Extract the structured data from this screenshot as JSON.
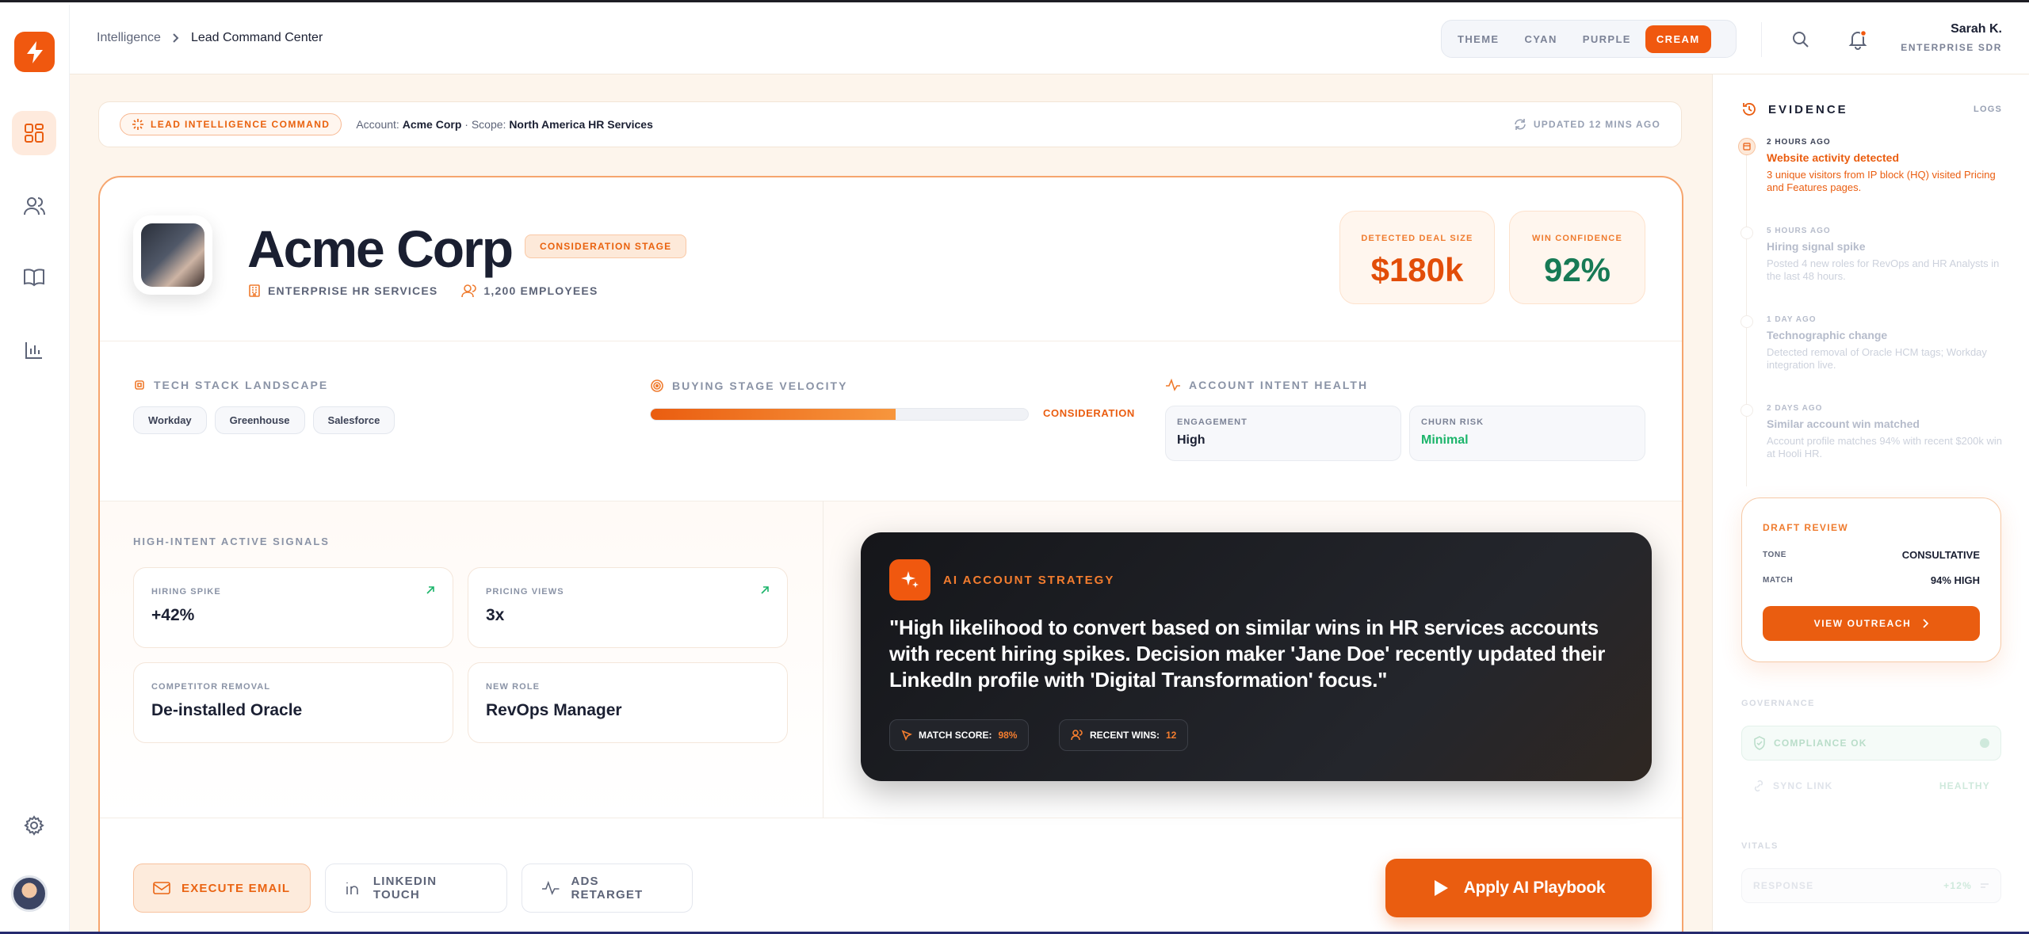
{
  "header": {
    "breadcrumb": [
      "Intelligence",
      "Lead Command Center"
    ],
    "theme_options": [
      "THEME",
      "CYAN",
      "PURPLE",
      "CREAM"
    ],
    "active_theme": "CREAM",
    "user": {
      "name": "Sarah K.",
      "role": "ENTERPRISE SDR"
    }
  },
  "sidebar": {
    "icons": [
      "dashboard-icon",
      "users-icon",
      "book-icon",
      "bar-chart-icon",
      "settings-icon"
    ]
  },
  "command_bar": {
    "badge": "LEAD INTELLIGENCE COMMAND",
    "account_label": "Account:",
    "account": "Acme Corp",
    "scope_label": "· Scope:",
    "scope": "North America HR Services",
    "updated": "UPDATED 12 MINS AGO"
  },
  "company": {
    "name": "Acme Corp",
    "stage_badge": "CONSIDERATION STAGE",
    "industry": "ENTERPRISE HR SERVICES",
    "employees": "1,200 EMPLOYEES"
  },
  "kpis": {
    "deal_size_label": "DETECTED DEAL SIZE",
    "deal_size": "$180k",
    "win_conf_label": "WIN CONFIDENCE",
    "win_conf": "92%"
  },
  "tech_stack": {
    "title": "TECH STACK LANDSCAPE",
    "items": [
      "Workday",
      "Greenhouse",
      "Salesforce"
    ]
  },
  "velocity": {
    "title": "BUYING STAGE VELOCITY",
    "stage": "CONSIDERATION",
    "progress": 0.65
  },
  "intent": {
    "title": "ACCOUNT INTENT HEALTH",
    "engagement_label": "ENGAGEMENT",
    "engagement": "High",
    "churn_label": "CHURN RISK",
    "churn": "Minimal",
    "churn_color": "#1bb46a"
  },
  "signals": {
    "title": "HIGH-INTENT ACTIVE SIGNALS",
    "items": [
      {
        "label": "HIRING SPIKE",
        "value": "+42%"
      },
      {
        "label": "PRICING VIEWS",
        "value": "3x"
      },
      {
        "label": "COMPETITOR REMOVAL",
        "value": "De-installed Oracle"
      },
      {
        "label": "NEW ROLE",
        "value": "RevOps Manager"
      }
    ]
  },
  "ai_strategy": {
    "title": "AI ACCOUNT STRATEGY",
    "text": "\"High likelihood to convert based on similar wins in HR services accounts with recent hiring spikes. Decision maker 'Jane Doe' recently updated their LinkedIn profile with 'Digital Transformation' focus.\"",
    "match_label": "MATCH SCORE:",
    "match_value": "98%",
    "wins_label": "RECENT WINS:",
    "wins_value": "12"
  },
  "actions": {
    "email": "EXECUTE EMAIL",
    "linkedin": "LINKEDIN TOUCH",
    "ads": "ADS RETARGET",
    "apply": "Apply AI Playbook"
  },
  "evidence": {
    "title": "EVIDENCE",
    "logs": "LOGS",
    "items": [
      {
        "time": "2 HOURS AGO",
        "title": "Website activity detected",
        "desc": "3 unique visitors from IP block (HQ) visited Pricing and Features pages."
      },
      {
        "time": "5 HOURS AGO",
        "title": "Hiring signal spike",
        "desc": "Posted 4 new roles for RevOps and HR Analysts in the last 48 hours."
      },
      {
        "time": "1 DAY AGO",
        "title": "Technographic change",
        "desc": "Detected removal of Oracle HCM tags; Workday integration live."
      },
      {
        "time": "2 DAYS AGO",
        "title": "Similar account win matched",
        "desc": "Account profile matches 94% with recent $200k win at Hooli HR."
      }
    ]
  },
  "draft_review": {
    "title": "DRAFT REVIEW",
    "tone_label": "TONE",
    "tone": "CONSULTATIVE",
    "match_label": "MATCH",
    "match": "94% HIGH",
    "button": "VIEW OUTREACH"
  },
  "governance": {
    "title": "GOVERNANCE",
    "compliance": "COMPLIANCE OK",
    "sync": "SYNC LINK",
    "sync_status": "HEALTHY"
  },
  "vitals": {
    "title": "VITALS",
    "response_label": "RESPONSE",
    "response_value": "+12%"
  }
}
